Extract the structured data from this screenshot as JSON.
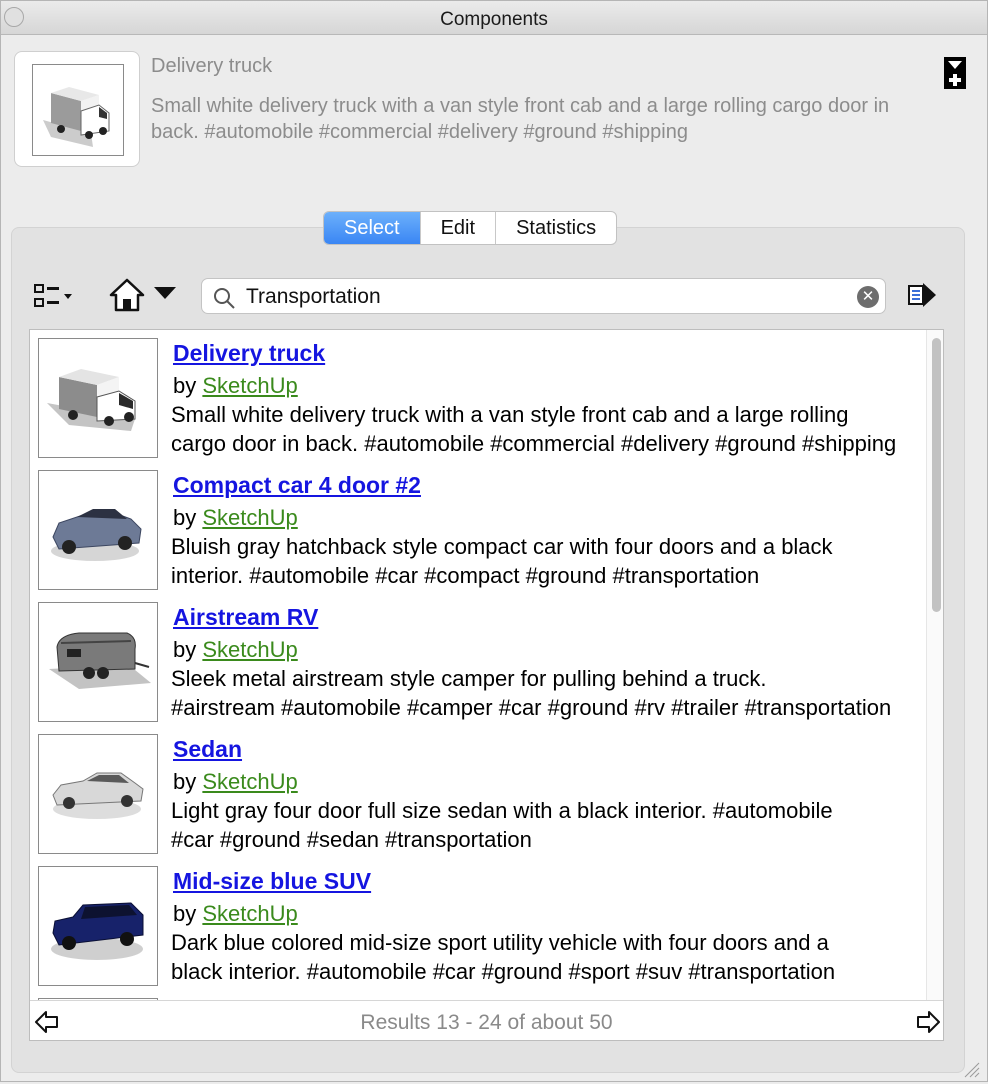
{
  "window": {
    "title": "Components"
  },
  "selected_component": {
    "name": "Delivery truck",
    "description": "Small white delivery truck with a van style front cab and a large rolling cargo door in back. #automobile #commercial #delivery #ground #shipping"
  },
  "tabs": [
    {
      "label": "Select",
      "active": true
    },
    {
      "label": "Edit",
      "active": false
    },
    {
      "label": "Statistics",
      "active": false
    }
  ],
  "search": {
    "value": "Transportation"
  },
  "results": [
    {
      "title": "Delivery truck",
      "by": "by",
      "author": "SketchUp",
      "desc_line1": "Small white delivery truck with a van style front cab and a large rolling",
      "desc_line2": "cargo door in back. #automobile #commercial #delivery #ground #shipping"
    },
    {
      "title": "Compact car 4 door #2",
      "by": "by",
      "author": "SketchUp",
      "desc_line1": "Bluish gray hatchback style compact car with four doors and a black",
      "desc_line2": "interior. #automobile #car #compact #ground #transportation"
    },
    {
      "title": "Airstream RV",
      "by": "by",
      "author": "SketchUp",
      "desc_line1": "Sleek metal airstream style camper for pulling behind a truck.",
      "desc_line2": "#airstream #automobile #camper #car #ground #rv #trailer #transportation"
    },
    {
      "title": "Sedan",
      "by": "by",
      "author": "SketchUp",
      "desc_line1": "Light gray four door full size sedan with a black interior. #automobile",
      "desc_line2": "#car #ground #sedan #transportation"
    },
    {
      "title": "Mid-size blue SUV",
      "by": "by",
      "author": "SketchUp",
      "desc_line1": "Dark blue colored mid-size sport utility vehicle with four doors and a",
      "desc_line2": "black interior. #automobile #car #ground #sport #suv #transportation"
    }
  ],
  "pager": {
    "text": "Results 13 - 24 of about 50"
  },
  "colors": {
    "tab_active": "#3a86f4",
    "link": "#1515e0",
    "author": "#3a8a1c"
  },
  "icons": [
    "close-dot-icon",
    "details-toggle-icon",
    "view-options-icon",
    "home-icon",
    "dropdown-arrow-icon",
    "search-icon",
    "clear-icon",
    "navigate-arrow-icon",
    "prev-page-icon",
    "next-page-icon",
    "resize-grip-icon"
  ]
}
